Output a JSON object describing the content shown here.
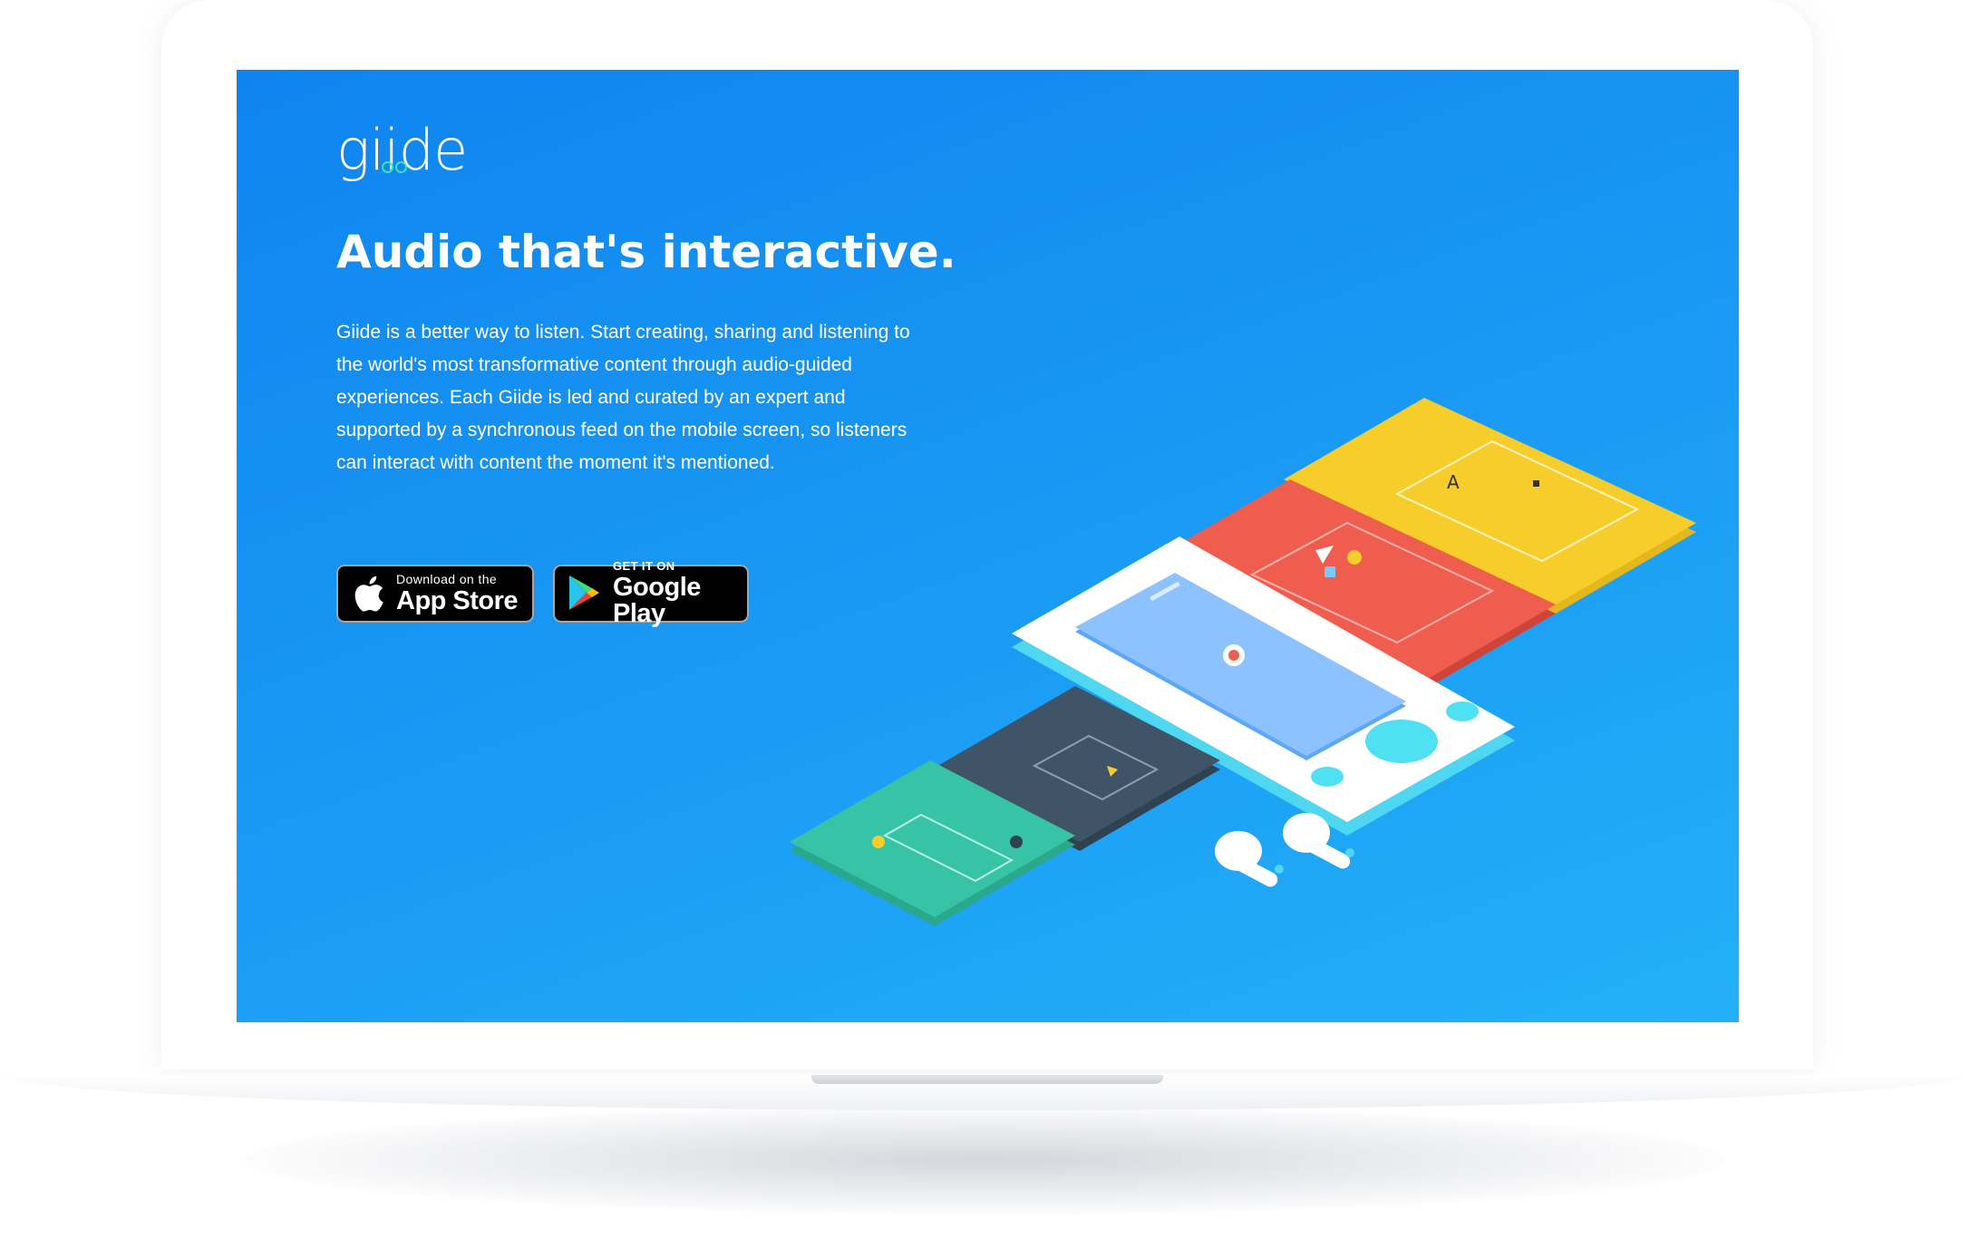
{
  "brand": {
    "logo_text": "giide",
    "accent_color": "#3ee0c8"
  },
  "hero": {
    "headline": "Audio that's interactive.",
    "description": "Giide is a better way to listen. Start creating, sharing and listening to the world's most transformative content through audio-guided experiences. Each Giide is led and curated by an expert and supported by a synchronous feed on the mobile screen, so listeners can interact with content the moment it's mentioned."
  },
  "buttons": {
    "app_store": {
      "small": "Download on the",
      "big": "App Store",
      "icon": "apple-icon"
    },
    "google_play": {
      "small": "GET IT ON",
      "big": "Google Play",
      "icon": "google-play-icon"
    }
  },
  "colors": {
    "screen_top": "#0f84ef",
    "screen_bottom": "#24b0f8",
    "card_yellow": "#f7cd2c",
    "card_red": "#ef5d4f",
    "card_dark": "#3f5466",
    "card_green": "#37c4a6",
    "phone": "#ffffff"
  }
}
